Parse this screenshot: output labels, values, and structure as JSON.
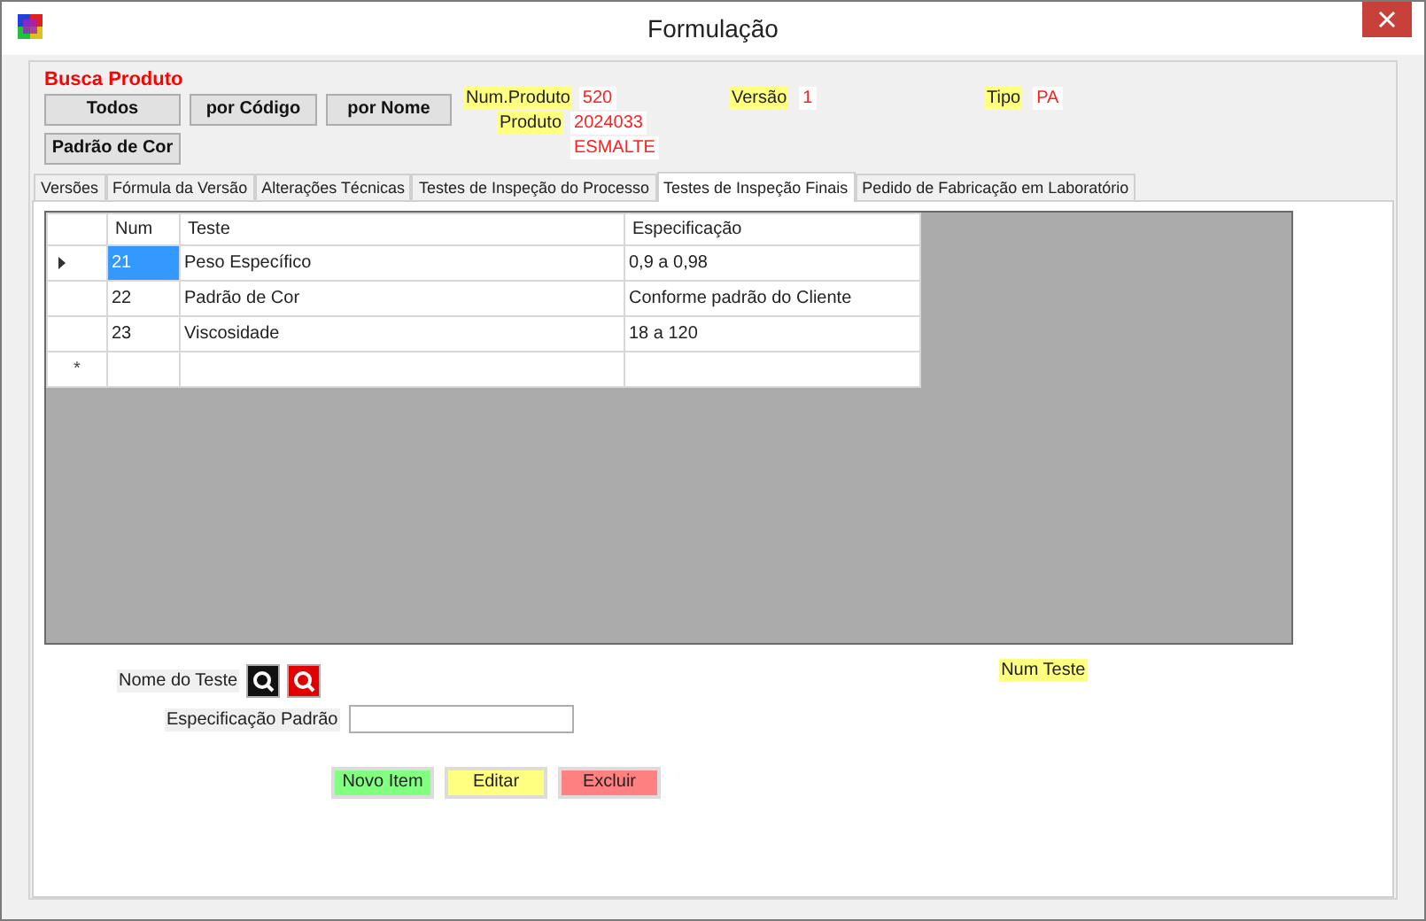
{
  "window": {
    "title": "Formulação"
  },
  "search": {
    "title": "Busca Produto",
    "buttons": [
      "Todos",
      "por Código",
      "por Nome",
      "Padrão de Cor"
    ]
  },
  "info": {
    "num_produto": {
      "label": "Num.Produto",
      "value": "520"
    },
    "produto": {
      "label": "Produto",
      "value": "2024033",
      "name": "ESMALTE"
    },
    "versao": {
      "label": "Versão",
      "value": "1"
    },
    "tipo": {
      "label": "Tipo",
      "value": "PA"
    }
  },
  "tabs": [
    {
      "label": "Versões",
      "selected": false
    },
    {
      "label": "Fórmula da Versão",
      "selected": false
    },
    {
      "label": "Alterações Técnicas",
      "selected": false
    },
    {
      "label": "Testes de Inspeção do Processo",
      "selected": false
    },
    {
      "label": "Testes de Inspeção Finais",
      "selected": true
    },
    {
      "label": "Pedido de Fabricação em Laboratório",
      "selected": false
    }
  ],
  "table": {
    "columns": [
      "Num",
      "Teste",
      "Especificação"
    ],
    "rows": [
      {
        "cells": [
          "21",
          "Peso Específico",
          "0,9 a 0,98"
        ],
        "selected": true
      },
      {
        "cells": [
          "22",
          "Padrão de Cor",
          "Conforme padrão do Cliente"
        ],
        "selected": false
      },
      {
        "cells": [
          "23",
          "Viscosidade",
          "18 a 120"
        ],
        "selected": false
      }
    ],
    "new_row_marker": "*"
  },
  "form": {
    "test_name_label": "Nome do Teste",
    "num_test_label": "Num Teste",
    "spec_label": "Especificação Padrão",
    "buttons": [
      {
        "label": "Novo Item",
        "color": "#80ff80"
      },
      {
        "label": "Editar",
        "color": "#ffff80"
      },
      {
        "label": "Excluir",
        "color": "#ff8080"
      }
    ]
  }
}
